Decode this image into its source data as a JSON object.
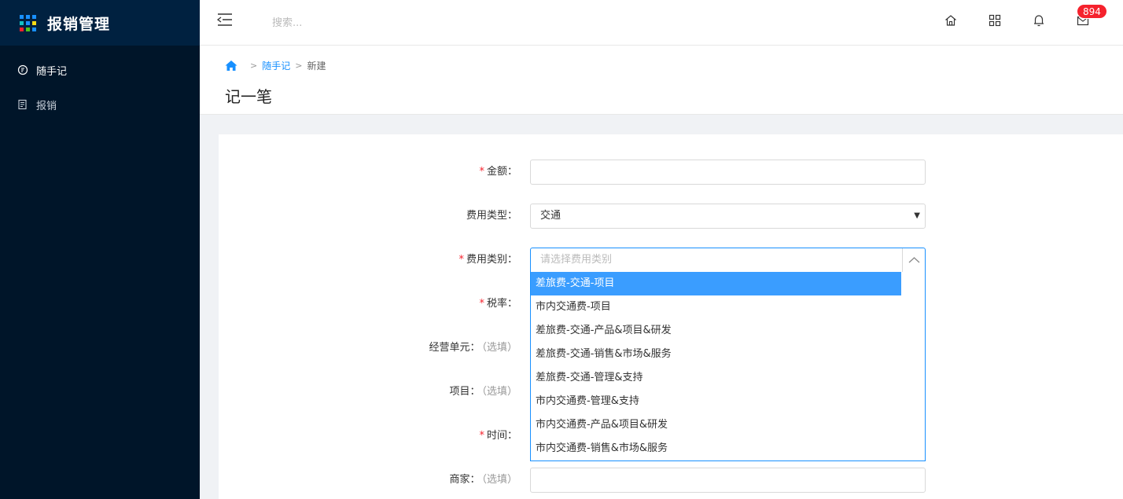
{
  "app": {
    "title": "报销管理",
    "grid_colors": [
      "#1890ff",
      "#1890ff",
      "#1890ff",
      "#13c2c2",
      "#1890ff",
      "#fadb14",
      "#f5222d",
      "#52c41a",
      "#1890ff"
    ]
  },
  "sidebar": {
    "items": [
      {
        "label": "随手记",
        "icon": "note-icon",
        "active": true
      },
      {
        "label": "报销",
        "icon": "document-icon",
        "active": false
      }
    ]
  },
  "header": {
    "search_placeholder": "搜索...",
    "notification_count": "894",
    "icons": [
      "home-icon",
      "apps-grid-icon",
      "bell-icon",
      "mail-icon"
    ]
  },
  "breadcrumb": {
    "separator": ">",
    "items": [
      "随手记",
      "新建"
    ]
  },
  "page": {
    "title": "记一笔"
  },
  "form": {
    "optional_label": "（选填）",
    "fields": {
      "amount": {
        "label": "金额：",
        "required": true,
        "value": ""
      },
      "expense_type": {
        "label": "费用类型：",
        "required": false,
        "value": "交通"
      },
      "expense_category": {
        "label": "费用类别：",
        "required": true,
        "placeholder": "请选择费用类别"
      },
      "tax_rate": {
        "label": "税率：",
        "required": true
      },
      "business_unit": {
        "label": "经营单元：",
        "required": false
      },
      "project": {
        "label": "项目：",
        "required": false
      },
      "time": {
        "label": "时间：",
        "required": true
      },
      "merchant": {
        "label": "商家：",
        "required": false,
        "value": ""
      }
    },
    "category_options": [
      "差旅费-交通-项目",
      "市内交通费-项目",
      "差旅费-交通-产品&项目&研发",
      "差旅费-交通-销售&市场&服务",
      "差旅费-交通-管理&支持",
      "市内交通费-管理&支持",
      "市内交通费-产品&项目&研发",
      "市内交通费-销售&市场&服务"
    ],
    "highlighted_option_index": 0
  },
  "colors": {
    "sidebar_bg": "#001529",
    "accent": "#1890ff",
    "required": "#f5222d",
    "badge": "#f5222d"
  }
}
